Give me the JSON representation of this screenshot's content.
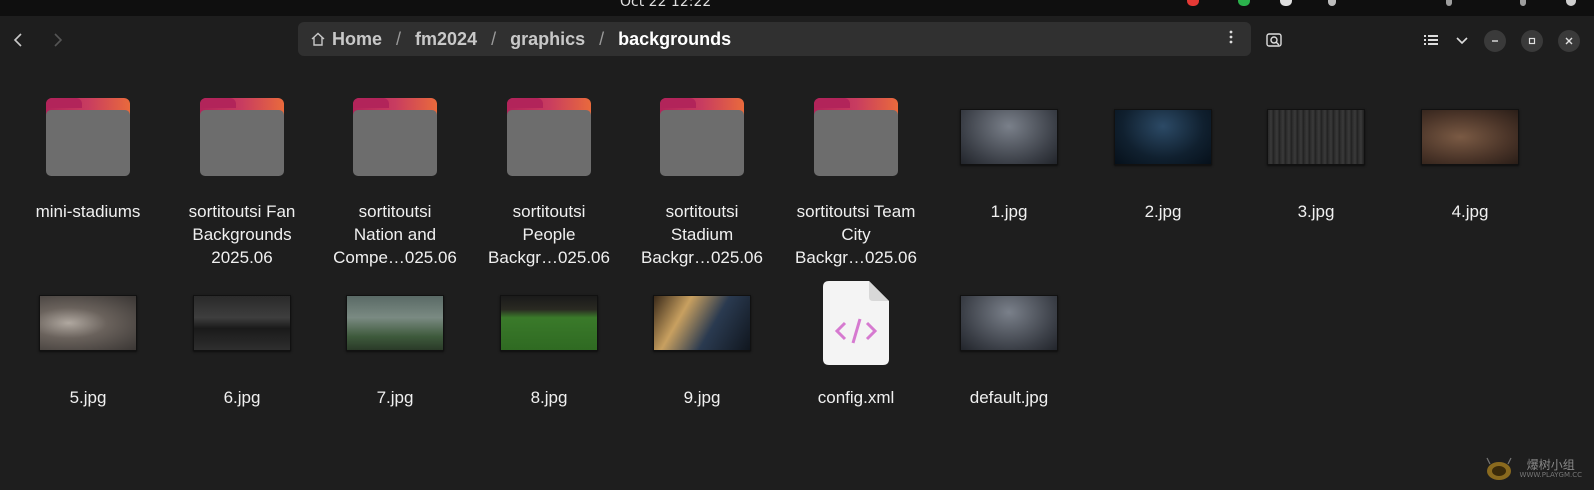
{
  "topbar": {
    "clock": "Oct 22  12:22"
  },
  "header": {
    "back_icon": "chevron-left-icon",
    "forward_icon": "chevron-right-icon",
    "breadcrumbs": [
      {
        "label": "Home"
      },
      {
        "label": "fm2024"
      },
      {
        "label": "graphics"
      },
      {
        "label": "backgrounds"
      }
    ],
    "separator": "/"
  },
  "files": [
    {
      "name": "mini-stadiums",
      "type": "folder",
      "lines": [
        "mini-stadiums"
      ]
    },
    {
      "name": "sortitoutsi Fan Backgrounds 2025.06",
      "type": "folder",
      "lines": [
        "sortitoutsi Fan",
        "Backgrounds",
        "2025.06"
      ]
    },
    {
      "name": "sortitoutsi Nation and Compe…025.06",
      "type": "folder",
      "lines": [
        "sortitoutsi",
        "Nation and",
        "Compe…025.06"
      ]
    },
    {
      "name": "sortitoutsi People Backgr…025.06",
      "type": "folder",
      "lines": [
        "sortitoutsi",
        "People",
        "Backgr…025.06"
      ]
    },
    {
      "name": "sortitoutsi Stadium Backgr…025.06",
      "type": "folder",
      "lines": [
        "sortitoutsi",
        "Stadium",
        "Backgr…025.06"
      ]
    },
    {
      "name": "sortitoutsi Team City Backgr…025.06",
      "type": "folder",
      "lines": [
        "sortitoutsi Team",
        "City",
        "Backgr…025.06"
      ]
    },
    {
      "name": "1.jpg",
      "type": "image",
      "lines": [
        "1.jpg"
      ]
    },
    {
      "name": "2.jpg",
      "type": "image",
      "lines": [
        "2.jpg"
      ]
    },
    {
      "name": "3.jpg",
      "type": "image",
      "lines": [
        "3.jpg"
      ]
    },
    {
      "name": "4.jpg",
      "type": "image",
      "lines": [
        "4.jpg"
      ]
    },
    {
      "name": "5.jpg",
      "type": "image",
      "lines": [
        "5.jpg"
      ]
    },
    {
      "name": "6.jpg",
      "type": "image",
      "lines": [
        "6.jpg"
      ]
    },
    {
      "name": "7.jpg",
      "type": "image",
      "lines": [
        "7.jpg"
      ]
    },
    {
      "name": "8.jpg",
      "type": "image",
      "lines": [
        "8.jpg"
      ]
    },
    {
      "name": "9.jpg",
      "type": "image",
      "lines": [
        "9.jpg"
      ]
    },
    {
      "name": "config.xml",
      "type": "xml",
      "lines": [
        "config.xml"
      ]
    },
    {
      "name": "default.jpg",
      "type": "image",
      "lines": [
        "default.jpg"
      ]
    }
  ],
  "watermark": {
    "text": "爆树小组",
    "url": "WWW.PLAYGM.CC"
  }
}
